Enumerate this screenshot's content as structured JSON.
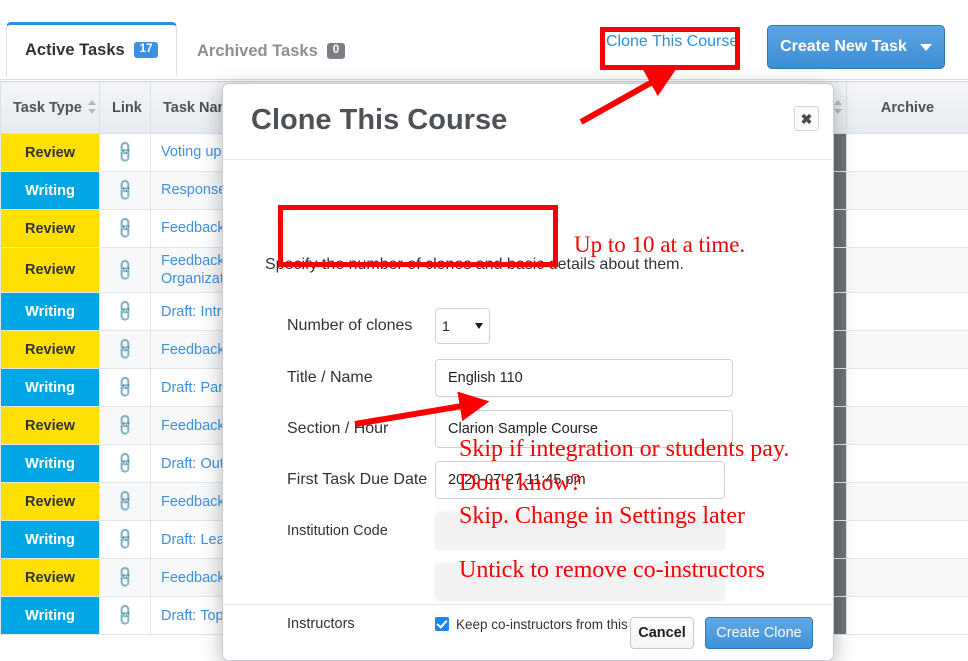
{
  "tabs": [
    {
      "label": "Active Tasks",
      "count": "17",
      "active": true
    },
    {
      "label": "Archived Tasks",
      "count": "0",
      "active": false
    }
  ],
  "toolbar": {
    "clone_link": "Clone This Course",
    "create_task_button": "Create New Task"
  },
  "table": {
    "columns": [
      "Task Type",
      "Link",
      "Task Nam",
      "Archive"
    ],
    "rows": [
      {
        "type": "Review",
        "type_class": "review",
        "link": "link-icon",
        "name": "Voting up"
      },
      {
        "type": "Writing",
        "type_class": "writing",
        "link": "link-icon",
        "name": "Response"
      },
      {
        "type": "Review",
        "type_class": "review",
        "link": "link-icon",
        "name": "Feedback"
      },
      {
        "type": "Review",
        "type_class": "review",
        "link": "link-icon",
        "name": "Feedback\nOrganizat"
      },
      {
        "type": "Writing",
        "type_class": "writing",
        "link": "link-icon",
        "name": "Draft: Intro"
      },
      {
        "type": "Review",
        "type_class": "review",
        "link": "link-icon",
        "name": "Feedback"
      },
      {
        "type": "Writing",
        "type_class": "writing",
        "link": "link-icon",
        "name": "Draft: Par"
      },
      {
        "type": "Review",
        "type_class": "review",
        "link": "link-icon",
        "name": "Feedback"
      },
      {
        "type": "Writing",
        "type_class": "writing",
        "link": "link-icon",
        "name": "Draft: Out"
      },
      {
        "type": "Review",
        "type_class": "review",
        "link": "link-icon",
        "name": "Feedback"
      },
      {
        "type": "Writing",
        "type_class": "writing",
        "link": "link-icon",
        "name": "Draft: Lea"
      },
      {
        "type": "Review",
        "type_class": "review",
        "link": "link-icon",
        "name": "Feedback"
      },
      {
        "type": "Writing",
        "type_class": "writing",
        "link": "link-icon",
        "name": "Draft: Top"
      }
    ]
  },
  "modal": {
    "title": "Clone This Course",
    "close_label": "✖",
    "intro": "Specify the number of clones and basic details about them.",
    "fields": {
      "clones_label": "Number of clones",
      "clones_value": "1",
      "title_label": "Title / Name",
      "title_value": "English 110",
      "section_label": "Section / Hour",
      "section_value": "Clarion Sample Course",
      "due_label": "First Task Due Date",
      "due_value": "2020-07-27 11:45 pm",
      "institution_label": "Institution Code",
      "institution_value": "",
      "instructors_label": "Instructors",
      "keep_coinstructors_label": "Keep co-instructors from this course.",
      "keep_coinstructors_checked": true
    },
    "footer": {
      "cancel": "Cancel",
      "create": "Create Clone"
    }
  },
  "annotations": {
    "up_to_ten": "Up to 10 at a time.",
    "skip_if_integration": "Skip if integration or students pay.",
    "dont_know": "Don't know?",
    "skip_change_settings": "Skip. Change in Settings later",
    "untick_remove": "Untick to remove co-instructors"
  },
  "colors": {
    "accent_blue": "#3d8fe0",
    "review_yellow": "#ffe000",
    "writing_blue": "#00a7e4",
    "annotation_red": "#fa0000",
    "tab_active_top": "#2a8fe0"
  }
}
